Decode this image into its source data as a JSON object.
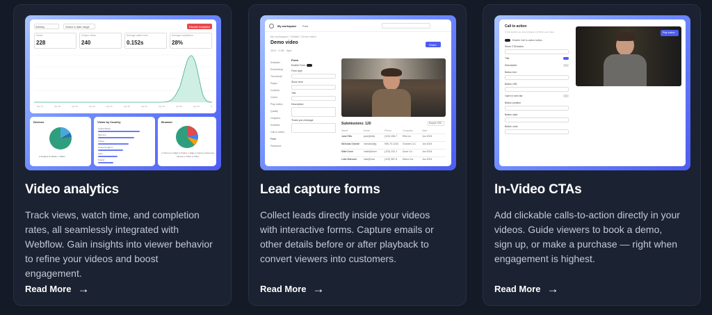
{
  "cards": [
    {
      "title": "Video analytics",
      "description": "Track views, watch time, and completion rates, all seamlessly integrated with Webflow. Gain insights into viewer behavior to refine your videos and boost engagement.",
      "cta": "Read More",
      "shot": {
        "range_select": "Weekly",
        "date_input": "Select a date range",
        "export_button": "Disable Analytics",
        "stats": [
          {
            "label": "Views",
            "value": "228"
          },
          {
            "label": "Unique views",
            "value": "240"
          },
          {
            "label": "Average watch time",
            "value": "0.152s"
          },
          {
            "label": "Average completion",
            "value": "28%"
          }
        ],
        "x_ticks": [
          "Apr 17",
          "Apr 18",
          "Apr 19",
          "Apr 20",
          "Apr 21",
          "Apr 22",
          "Apr 23",
          "Apr 24",
          "Apr 25",
          "Apr 26",
          "Apr 27"
        ],
        "panels": [
          {
            "title": "Devices",
            "legend": [
              "Desktop",
              "Mobile",
              "Tablet"
            ]
          },
          {
            "title": "Views by Country",
            "rows": [
              "United States",
              "Morocco",
              "Turkey",
              "United Kingdom",
              "India",
              "Poland"
            ]
          },
          {
            "title": "Browser",
            "legend": [
              "Chrome",
              "Safari",
              "Firefox",
              "Edge",
              "Opera",
              "Samsung Internet",
              "Other",
              "Other"
            ]
          }
        ]
      }
    },
    {
      "title": "Lead capture forms",
      "description": "Collect leads directly inside your videos with interactive forms. Capture emails or other details before or after playback to convert viewers into customers.",
      "cta": "Read More",
      "shot": {
        "workspace": "My workspace",
        "plan": "Free",
        "breadcrumb": "My workspace / Details / Demo video",
        "video_title": "Demo video",
        "meta": [
          "16:9",
          "2:33",
          "mp4"
        ],
        "share_button": "Share",
        "nav": [
          "Analytics",
          "Embedding",
          "Thumbnail",
          "Player",
          "Controls",
          "Colors",
          "Play button",
          "Quality",
          "Chapters",
          "Subtitles",
          "Call to action",
          "Form",
          "Password"
        ],
        "form_heading": "Form",
        "form_fields": [
          "Enable Form",
          "Form type",
          "Show form",
          "Title",
          "Description",
          "Thank you message"
        ],
        "submissions": "Submissions: 120",
        "export": "Export CSV",
        "table_headers": [
          "Name",
          "Email",
          "Phone",
          "Company",
          "Date"
        ],
        "rows": [
          [
            "Jane Ellis",
            "jane@ellis",
            "(123) 456-7",
            "Ellis Inc.",
            "Jun 2024"
          ],
          [
            "Nicholas Grande",
            "nicholas@g",
            "555-73-1234",
            "Grande LLC",
            "Jun 2024"
          ],
          [
            "Mike Dunn",
            "mike@dunn",
            "(123) 222-1",
            "Dunn Co",
            "Jun 2024"
          ],
          [
            "Luke Marcone",
            "luke@mar",
            "(123) 987-6",
            "Marco Inc",
            "Jun 2024"
          ]
        ]
      }
    },
    {
      "title": "In-Video CTAs",
      "description": "Add clickable calls-to-action directly in your videos. Guide viewers to book a demo, sign up, or make a purchase — right when engagement is highest.",
      "cta": "Read More",
      "shot": {
        "heading": "Call to action",
        "subtext": "In this section you can configure a CTA for your video.",
        "toggle_label": "Enable Call to action button",
        "overlay_button": "Play button",
        "fields": [
          "Show CTA button",
          "Title",
          "Description",
          "Button text",
          "Button URL",
          "Open in new tab",
          "Button position",
          "Button style",
          "Button color"
        ]
      }
    }
  ],
  "colors": {
    "page_bg": "#141a26",
    "card_bg": "#1b2232",
    "accent": "#4d5cf0",
    "text_muted": "#c3c9d6"
  }
}
